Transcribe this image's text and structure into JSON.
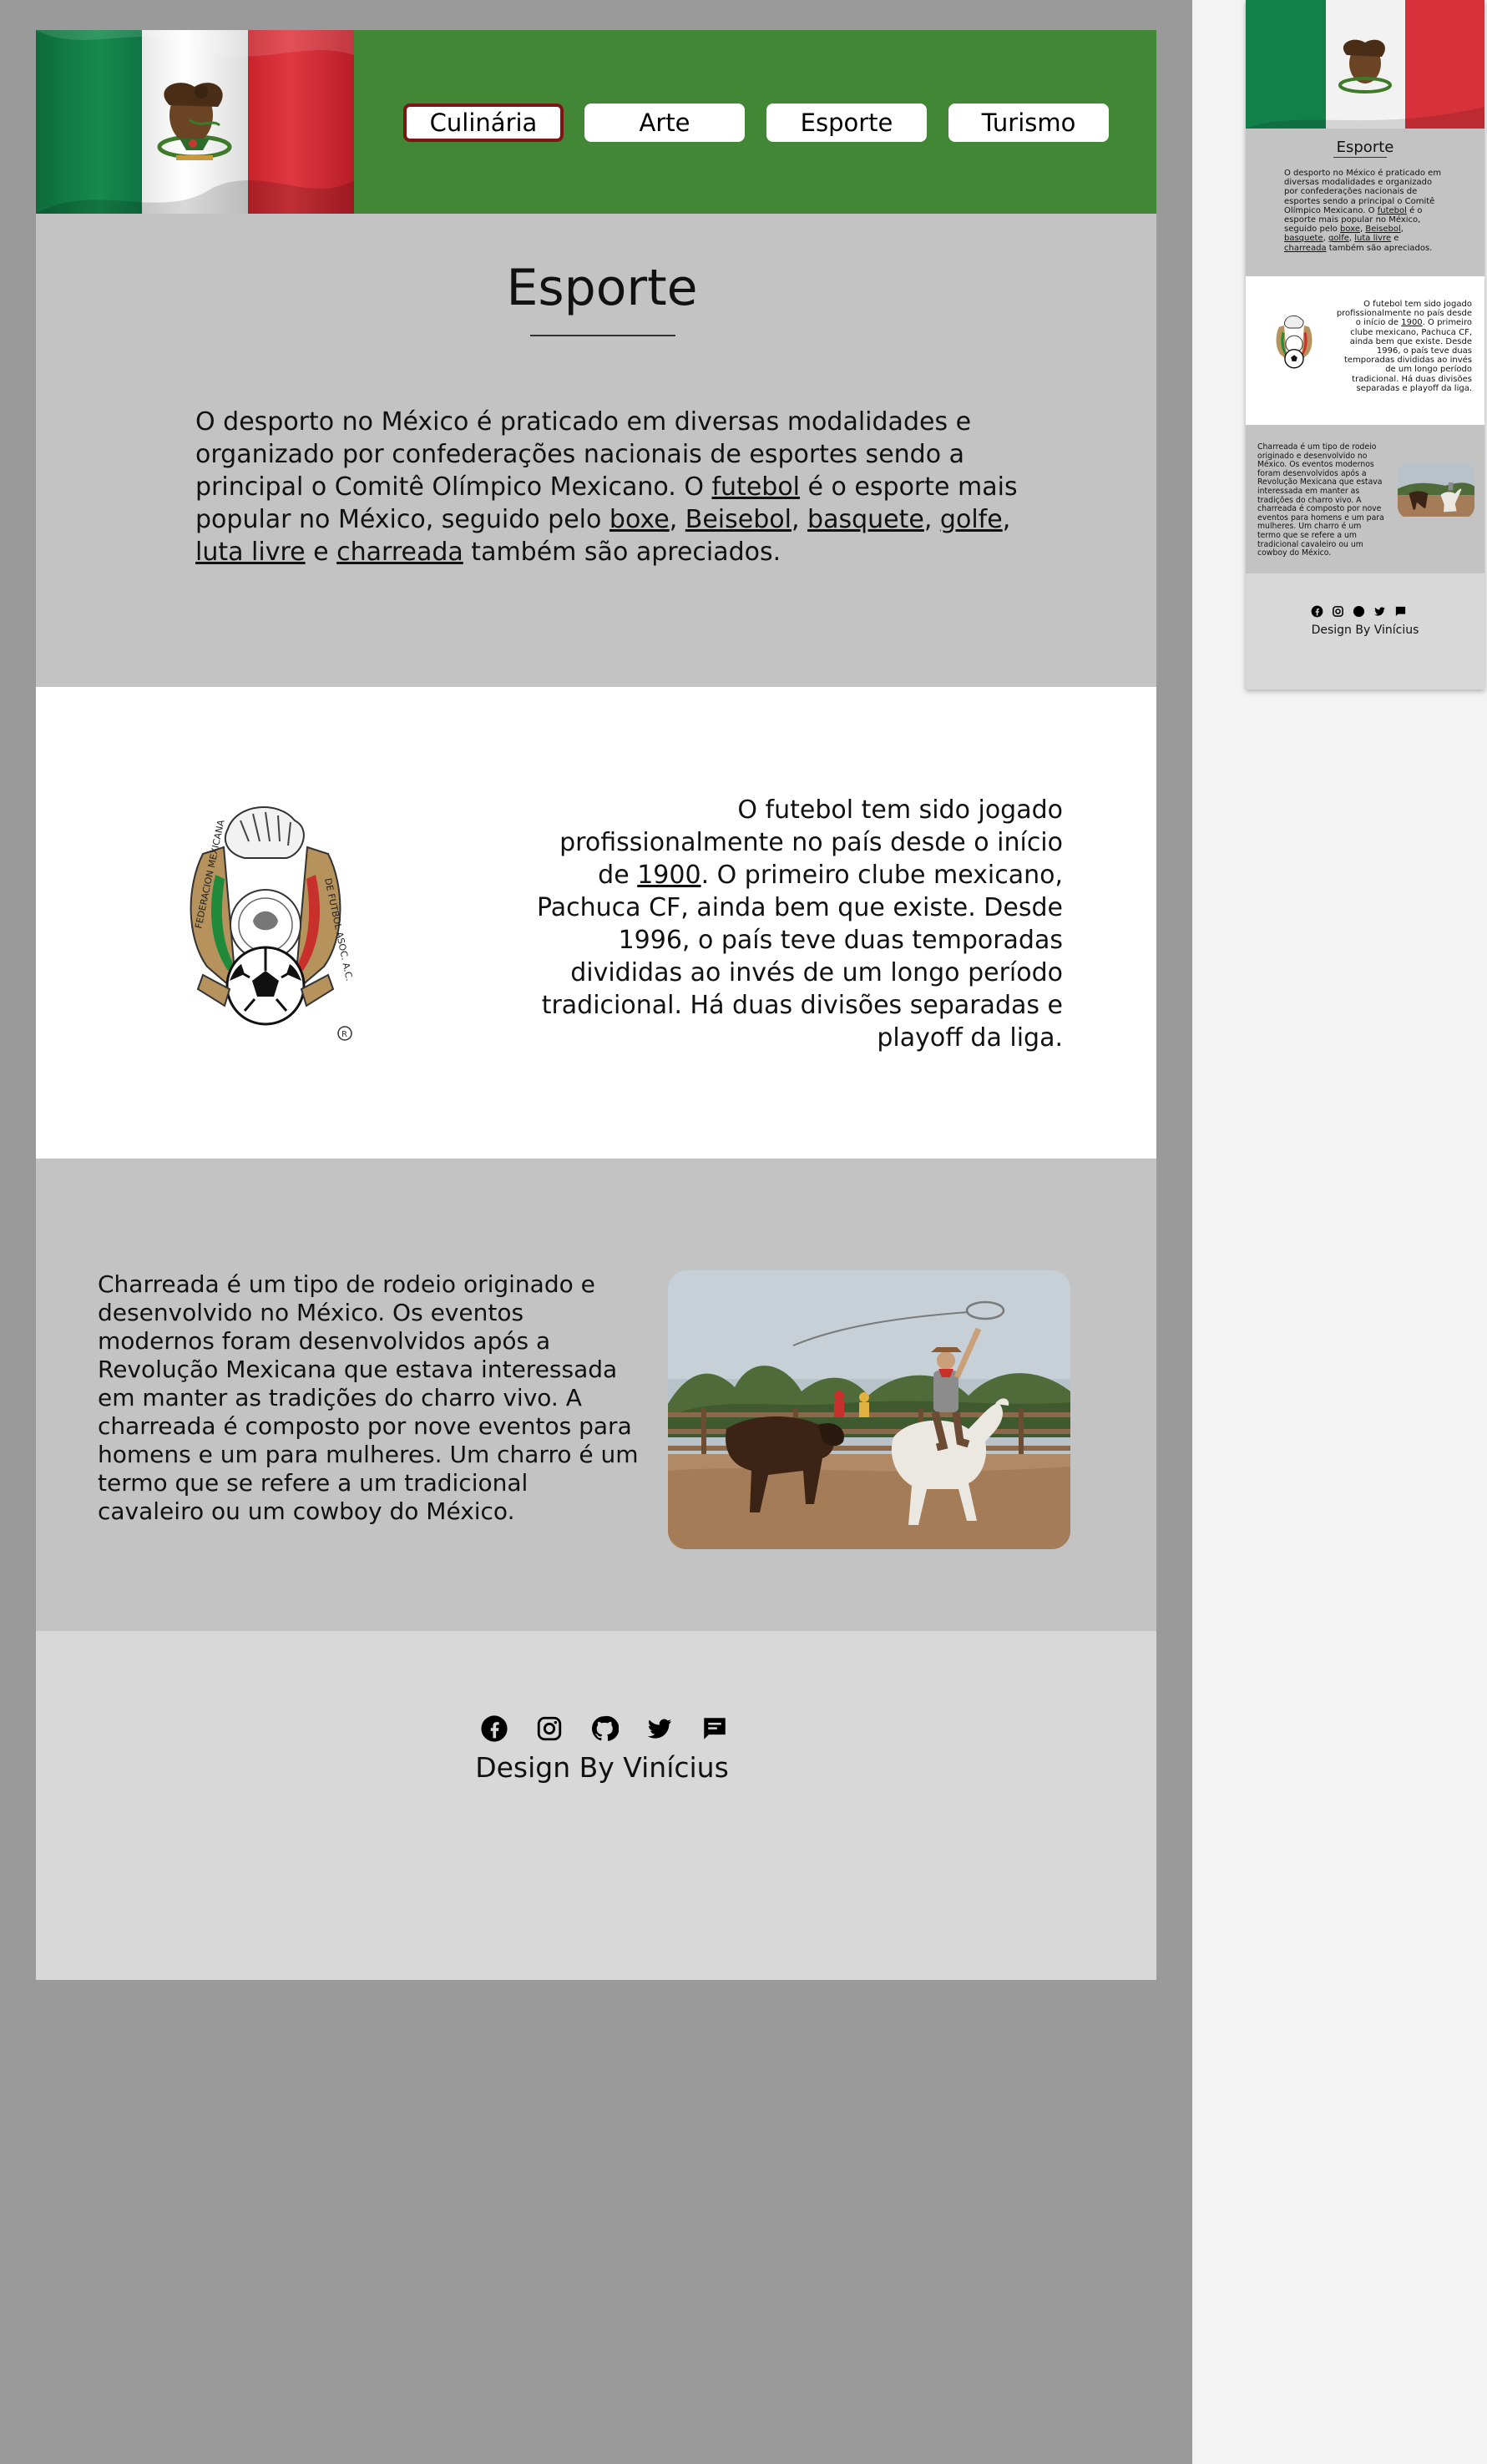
{
  "nav": {
    "items": [
      "Culinária",
      "Arte",
      "Esporte",
      "Turismo"
    ],
    "active": "Culinária"
  },
  "main": {
    "title": "Esporte",
    "intro": {
      "p1": "O desporto no México é praticado em diversas modalidades e organizado por confederações nacionais de esportes sendo a principal o Comitê Olímpico Mexicano. O ",
      "link_futebol": "futebol",
      "p2": " é o esporte mais popular no México, seguido pelo ",
      "link_boxe": "boxe",
      "sep1": ", ",
      "link_beisebol": "Beisebol",
      "sep2": ", ",
      "link_basquete": "basquete",
      "sep3": ", ",
      "link_golfe": "golfe",
      "sep4": ", ",
      "link_luta": "luta livre",
      "sep5": " e ",
      "link_charreada": "charreada",
      "p3": " também são apreciados."
    },
    "futebol": {
      "t1": "O futebol tem sido jogado profissionalmente no país desde o início de ",
      "link_1900": "1900",
      "t2": ". O primeiro clube mexicano, Pachuca CF, ainda bem que existe. Desde 1996, o país teve duas temporadas divididas ao invés de um longo período tradicional. Há duas divisões separadas e playoff da liga."
    },
    "charreada": "Charreada é um tipo de rodeio originado e desenvolvido no México. Os eventos modernos foram desenvolvidos após a Revolução Mexicana que estava interessada em manter as tradições do charro vivo. A charreada é composto por nove eventos para homens e um para mulheres. Um charro é um termo que se refere a um tradicional cavaleiro ou um cowboy do México."
  },
  "footer": {
    "icons": [
      "facebook-icon",
      "instagram-icon",
      "github-icon",
      "twitter-icon",
      "message-icon"
    ],
    "credit": "Design By Vinícius"
  },
  "colors": {
    "header_green": "#418735",
    "section_gray": "#c3c3c3",
    "footer_gray": "#d8d8d8",
    "active_border": "#7d1515",
    "canvas_bg": "#9a9a9a"
  }
}
